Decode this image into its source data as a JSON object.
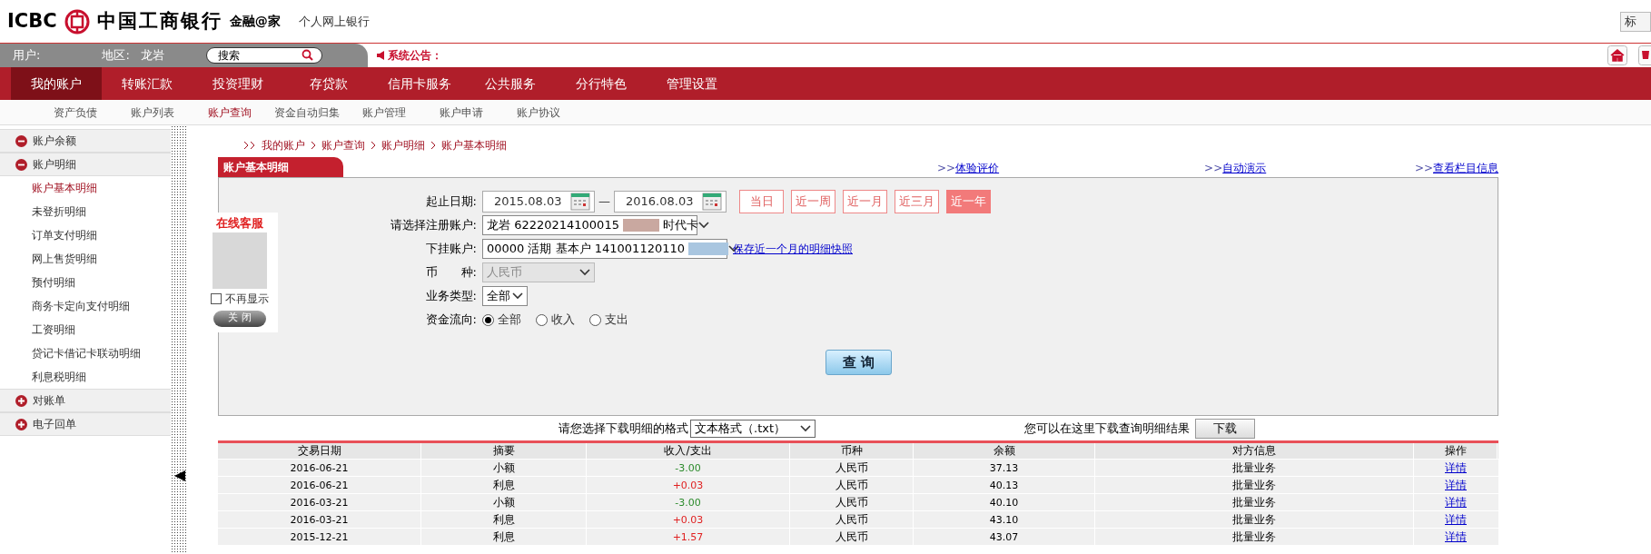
{
  "header": {
    "logo_text": "ICBC",
    "bank_name": "中国工商银行",
    "brand": "金融@家",
    "subtitle": "个人网上银行",
    "corner_button": "标"
  },
  "user_bar": {
    "user_label": "用户:",
    "region_label": "地区:",
    "region": "龙岩",
    "search": {
      "placeholder": "搜索"
    },
    "notice_label": "系统公告："
  },
  "nav": [
    {
      "label": "我的账户",
      "selected": true
    },
    {
      "label": "转账汇款",
      "selected": false
    },
    {
      "label": "投资理财",
      "selected": false
    },
    {
      "label": "存贷款",
      "selected": false
    },
    {
      "label": "信用卡服务",
      "selected": false
    },
    {
      "label": "公共服务",
      "selected": false
    },
    {
      "label": "分行特色",
      "selected": false
    },
    {
      "label": "管理设置",
      "selected": false
    }
  ],
  "subnav": [
    {
      "label": "资产负债",
      "selected": false
    },
    {
      "label": "账户列表",
      "selected": false
    },
    {
      "label": "账户查询",
      "selected": true
    },
    {
      "label": "资金自动归集",
      "selected": false
    },
    {
      "label": "账户管理",
      "selected": false
    },
    {
      "label": "账户申请",
      "selected": false
    },
    {
      "label": "账户协议",
      "selected": false
    }
  ],
  "sidebar": {
    "items": [
      {
        "label": "账户余额",
        "expanded": true
      },
      {
        "label": "账户明细",
        "expanded": true,
        "children": [
          {
            "label": "账户基本明细",
            "selected": true
          },
          {
            "label": "未登折明细",
            "selected": false
          },
          {
            "label": "订单支付明细",
            "selected": false
          },
          {
            "label": "网上售货明细",
            "selected": false
          },
          {
            "label": "预付明细",
            "selected": false
          },
          {
            "label": "商务卡定向支付明细",
            "selected": false
          },
          {
            "label": "工资明细",
            "selected": false
          },
          {
            "label": "贷记卡借记卡联动明细",
            "selected": false
          },
          {
            "label": "利息税明细",
            "selected": false
          }
        ]
      },
      {
        "label": "对账单",
        "expanded": false
      },
      {
        "label": "电子回单",
        "expanded": false
      }
    ]
  },
  "service_popup": {
    "title": "在线客服",
    "checkbox": {
      "label": "不再显示",
      "checked": false
    },
    "close_button": "关 闭"
  },
  "breadcrumb": [
    "我的账户",
    "账户查询",
    "账户明细",
    "账户基本明细"
  ],
  "panel": {
    "title": "账户基本明细",
    "links": [
      {
        "prefix": ">>",
        "label": "体验评价"
      },
      {
        "prefix": ">>",
        "label": "自动演示"
      },
      {
        "prefix": ">>",
        "label": "查看栏目信息"
      }
    ],
    "fields": [
      {
        "kind": "date_range",
        "label": "起止日期:",
        "start": "2015.08.03",
        "separator": "—",
        "end": "2016.08.03",
        "quick": [
          {
            "label": "当日",
            "selected": false
          },
          {
            "label": "近一周",
            "selected": false
          },
          {
            "label": "近一月",
            "selected": false
          },
          {
            "label": "近三月",
            "selected": false
          },
          {
            "label": "近一年",
            "selected": true
          }
        ]
      },
      {
        "kind": "select",
        "label": "请选择注册账户:",
        "value": "龙岩 62220214100015",
        "value_end": "时代卡",
        "disabled": false
      },
      {
        "kind": "select",
        "label": "下挂账户:",
        "value": "00000 活期 基本户 141001120110",
        "link": "保存近一个月的明细快照",
        "disabled": false
      },
      {
        "kind": "select",
        "label": "币　　种:",
        "value": "人民币",
        "disabled": true
      },
      {
        "kind": "small_select",
        "label": "业务类型:",
        "value": "全部",
        "disabled": false
      },
      {
        "kind": "radio",
        "label": "资金流向:",
        "options": [
          {
            "label": "全部",
            "selected": true
          },
          {
            "label": "收入",
            "selected": false
          },
          {
            "label": "支出",
            "selected": false
          }
        ]
      }
    ],
    "query_button": "查 询"
  },
  "download": {
    "label": "请您选择下载明细的格式",
    "format": "文本格式（.txt）",
    "hint": "您可以在这里下载查询明细结果",
    "button": "下载"
  },
  "table": {
    "columns": [
      "交易日期",
      "摘要",
      "收入/支出",
      "币种",
      "余额",
      "对方信息",
      "操作"
    ],
    "rows": [
      {
        "date": "2016-06-21",
        "summary": "小额",
        "amount": "-3.00",
        "kind": "expense",
        "currency": "人民币",
        "balance": "37.13",
        "counterparty": "批量业务",
        "action": "详情"
      },
      {
        "date": "2016-06-21",
        "summary": "利息",
        "amount": "+0.03",
        "kind": "income",
        "currency": "人民币",
        "balance": "40.13",
        "counterparty": "批量业务",
        "action": "详情"
      },
      {
        "date": "2016-03-21",
        "summary": "小额",
        "amount": "-3.00",
        "kind": "expense",
        "currency": "人民币",
        "balance": "40.10",
        "counterparty": "批量业务",
        "action": "详情"
      },
      {
        "date": "2016-03-21",
        "summary": "利息",
        "amount": "+0.03",
        "kind": "income",
        "currency": "人民币",
        "balance": "43.10",
        "counterparty": "批量业务",
        "action": "详情"
      },
      {
        "date": "2015-12-21",
        "summary": "利息",
        "amount": "+1.57",
        "kind": "income",
        "currency": "人民币",
        "balance": "43.07",
        "counterparty": "批量业务",
        "action": "详情"
      }
    ]
  }
}
